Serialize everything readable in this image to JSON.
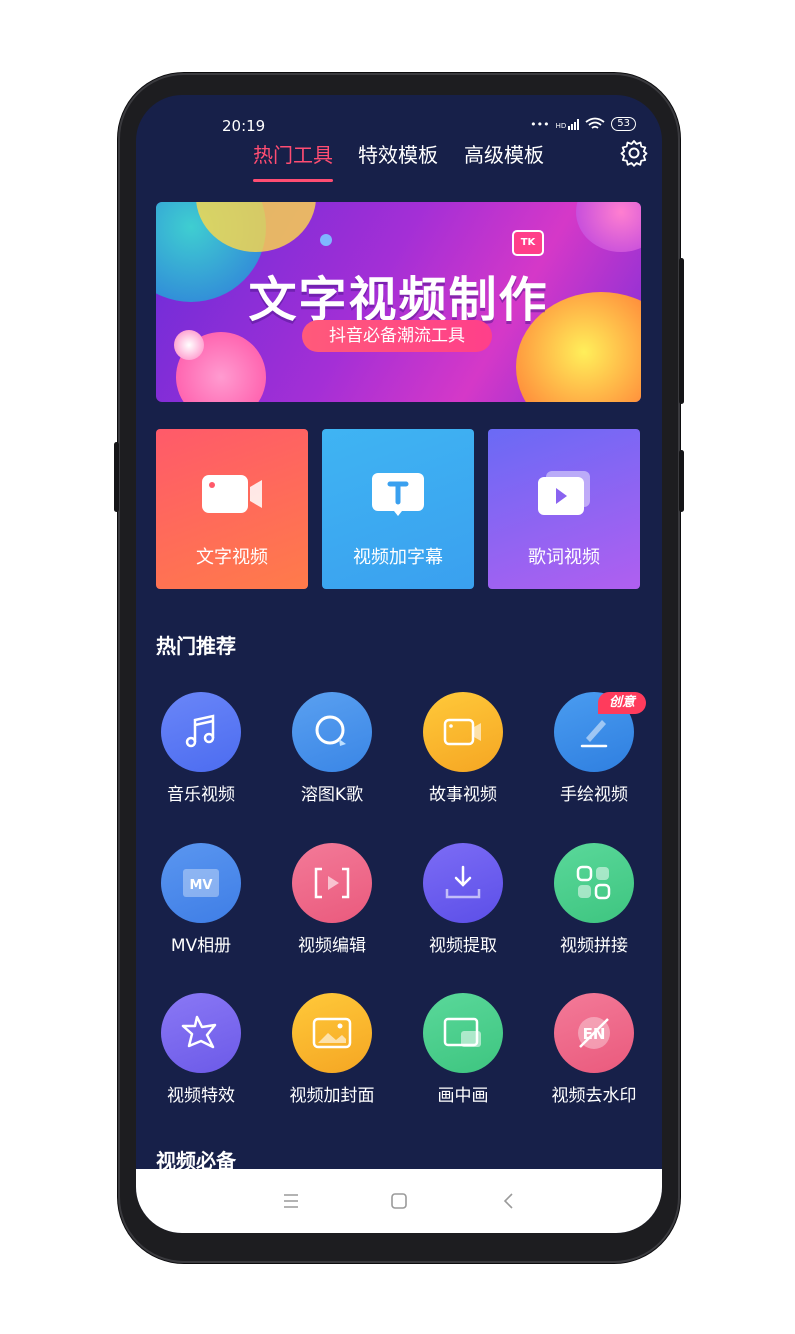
{
  "status_bar": {
    "time": "20:19",
    "signal_text": "HD",
    "battery": "53"
  },
  "tabs": [
    {
      "label": "热门工具",
      "active": true
    },
    {
      "label": "特效模板",
      "active": false
    },
    {
      "label": "高级模板",
      "active": false
    }
  ],
  "banner": {
    "title": "文字视频制作",
    "subtitle": "抖音必备潮流工具",
    "badge": "TK"
  },
  "feature_cards": [
    {
      "label": "文字视频",
      "icon": "camera-icon"
    },
    {
      "label": "视频加字幕",
      "icon": "subtitle-icon"
    },
    {
      "label": "歌词视频",
      "icon": "play-icon"
    }
  ],
  "hot_section": {
    "title": "热门推荐"
  },
  "hot_items": [
    {
      "label": "音乐视频",
      "icon": "music-note-icon",
      "color": "#5b7cf5"
    },
    {
      "label": "溶图K歌",
      "icon": "search-icon",
      "color": "#4a90e8"
    },
    {
      "label": "故事视频",
      "icon": "camera-icon",
      "color": "#f7b52b"
    },
    {
      "label": "手绘视频",
      "icon": "pen-icon",
      "color": "#3d8ee8",
      "badge": "创意"
    },
    {
      "label": "MV相册",
      "icon": "mv-icon",
      "color": "#4c8ce8"
    },
    {
      "label": "视频编辑",
      "icon": "edit-video-icon",
      "color": "#f06a8a"
    },
    {
      "label": "视频提取",
      "icon": "download-icon",
      "color": "#6c5cf0"
    },
    {
      "label": "视频拼接",
      "icon": "grid-icon",
      "color": "#4fd08e"
    },
    {
      "label": "视频特效",
      "icon": "star-icon",
      "color": "#7c6af0"
    },
    {
      "label": "视频加封面",
      "icon": "image-icon",
      "color": "#f7b52b"
    },
    {
      "label": "画中画",
      "icon": "pip-icon",
      "color": "#4fd08e"
    },
    {
      "label": "视频去水印",
      "icon": "no-watermark-icon",
      "color": "#f06a8a"
    }
  ],
  "essentials_section": {
    "title": "视频必备"
  },
  "colors": {
    "background": "#172049",
    "accent": "#ff4d72"
  }
}
